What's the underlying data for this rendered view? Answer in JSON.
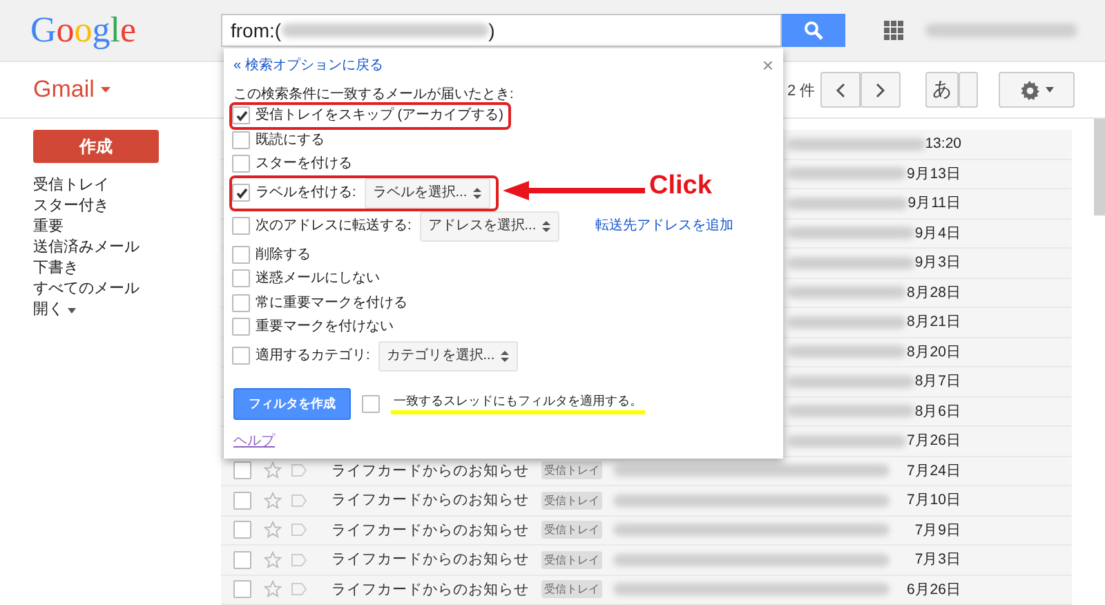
{
  "header": {
    "logo": "Google",
    "search": {
      "prefix": "from:(",
      "suffix": ")"
    }
  },
  "toolbar": {
    "app": "Gmail",
    "count": "2 件",
    "input_tool": "あ"
  },
  "sidebar": {
    "compose": "作成",
    "items": [
      {
        "label": "受信トレイ",
        "kind": "link"
      },
      {
        "label": "スター付き",
        "kind": "link"
      },
      {
        "label": "重要",
        "kind": "link"
      },
      {
        "label": "送信済みメール",
        "kind": "link"
      },
      {
        "label": "下書き",
        "kind": "link"
      },
      {
        "label": "すべてのメール",
        "kind": "link"
      },
      {
        "label": "開く",
        "kind": "menu"
      }
    ]
  },
  "messages": [
    {
      "date": "13:20"
    },
    {
      "date": "9月13日"
    },
    {
      "date": "9月11日"
    },
    {
      "date": "9月4日"
    },
    {
      "date": "9月3日"
    },
    {
      "date": "8月28日"
    },
    {
      "date": "8月21日"
    },
    {
      "date": "8月20日"
    },
    {
      "date": "8月7日"
    },
    {
      "date": "8月6日"
    },
    {
      "date": "7月26日"
    },
    {
      "sender": "ライフカードからのお知らせ",
      "label": "受信トレイ",
      "date": "7月24日",
      "checked": false
    },
    {
      "sender": "ライフカードからのお知らせ",
      "label": "受信トレイ",
      "date": "7月10日",
      "checked": false
    },
    {
      "sender": "ライフカードからのお知らせ",
      "label": "受信トレイ",
      "date": "7月9日",
      "checked": false
    },
    {
      "sender": "ライフカードからのお知らせ",
      "label": "受信トレイ",
      "date": "7月3日",
      "checked": false
    },
    {
      "sender": "ライフカードからのお知らせ",
      "label": "受信トレイ",
      "date": "6月26日",
      "checked": false
    }
  ],
  "filter_dialog": {
    "back_link": "« 検索オプションに戻る",
    "close": "×",
    "heading": "この検索条件に一致するメールが届いたとき:",
    "options": [
      {
        "kind": "checkbox",
        "label": "受信トレイをスキップ (アーカイブする)",
        "checked": true,
        "highlighted": true
      },
      {
        "kind": "checkbox",
        "label": "既読にする",
        "checked": false,
        "highlighted": false
      },
      {
        "kind": "checkbox",
        "label": "スターを付ける",
        "checked": false,
        "highlighted": false
      },
      {
        "kind": "select",
        "label": "ラベルを付ける:",
        "select": "ラベルを選択...",
        "checked": true,
        "highlighted": true
      },
      {
        "kind": "select",
        "label": "次のアドレスに転送する:",
        "select": "アドレスを選択...",
        "link": "転送先アドレスを追加",
        "checked": false,
        "highlighted": false
      },
      {
        "kind": "checkbox",
        "label": "削除する",
        "checked": false,
        "highlighted": false
      },
      {
        "kind": "checkbox",
        "label": "迷惑メールにしない",
        "checked": false,
        "highlighted": false
      },
      {
        "kind": "checkbox",
        "label": "常に重要マークを付ける",
        "checked": false,
        "highlighted": false
      },
      {
        "kind": "checkbox",
        "label": "重要マークを付けない",
        "checked": false,
        "highlighted": false
      },
      {
        "kind": "select",
        "label": "適用するカテゴリ:",
        "select": "カテゴリを選択...",
        "checked": false,
        "highlighted": false
      }
    ],
    "create_button": "フィルタを作成",
    "apply_threads": {
      "label": "一致するスレッドにもフィルタを適用する。",
      "checked": false,
      "highlighted": true
    },
    "help": "ヘルプ"
  },
  "annotation": {
    "text": "Click"
  }
}
